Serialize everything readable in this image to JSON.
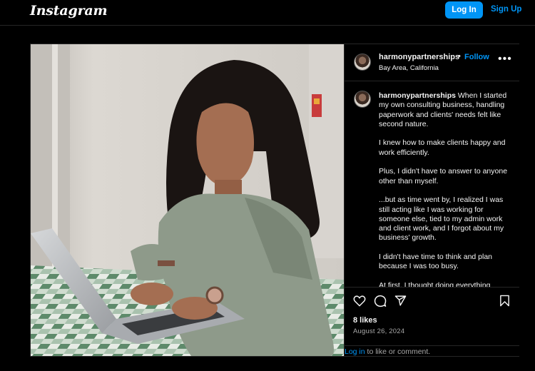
{
  "topbar": {
    "logo": "Instagram",
    "login_label": "Log In",
    "signup_label": "Sign Up"
  },
  "post": {
    "author": {
      "username": "harmonypartnerships",
      "separator": "•",
      "follow_label": "Follow",
      "location": "Bay Area, California"
    },
    "more_icon": "more-horizontal-icon",
    "caption": {
      "username": "harmonypartnerships",
      "paragraphs": [
        "When I started my own consulting business, handling paperwork and clients' needs felt like second nature.",
        "I knew how to make clients happy and work efficiently.",
        "Plus, I didn't have to answer to anyone other than myself.",
        "...but as time went by, I realized I was still acting like I was working for someone else, tied to my admin work and client work, and I forgot about my business' growth.",
        "I didn't have time to think and plan because I was too busy.",
        "At first, I thought doing everything"
      ]
    },
    "actions": {
      "like_icon": "heart-icon",
      "comment_icon": "comment-icon",
      "share_icon": "share-icon",
      "save_icon": "bookmark-icon"
    },
    "likes": "8 likes",
    "date": "August 26, 2024",
    "login_prompt": {
      "link": "Log in",
      "text": " to like or comment."
    }
  },
  "colors": {
    "background": "#000000",
    "accent": "#0095f6",
    "border": "#262626",
    "muted": "#a8a8a8"
  }
}
